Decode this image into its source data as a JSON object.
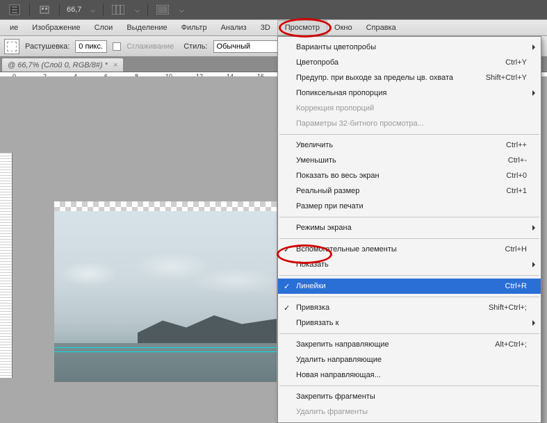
{
  "topbar": {
    "zoom": "66,7"
  },
  "menubar": {
    "items": [
      "ие",
      "Изображение",
      "Слои",
      "Выделение",
      "Фильтр",
      "Анализ",
      "3D",
      "Просмотр",
      "Окно",
      "Справка"
    ]
  },
  "optbar": {
    "feather_label": "Растушевка:",
    "feather_value": "0 пикс.",
    "antialias_label": "Сглаживание",
    "style_label": "Стиль:",
    "style_value": "Обычный"
  },
  "doctab": {
    "title": "@ 66,7% (Слой 0, RGB/8#) *",
    "close": "×"
  },
  "ruler": {
    "marks": [
      "0",
      "2",
      "4",
      "6",
      "8",
      "10",
      "12",
      "14",
      "16"
    ]
  },
  "menu": {
    "items": [
      {
        "label": "Варианты цветопробы",
        "submenu": true
      },
      {
        "label": "Цветопроба",
        "shortcut": "Ctrl+Y"
      },
      {
        "label": "Предупр. при выходе за пределы цв. охвата",
        "shortcut": "Shift+Ctrl+Y"
      },
      {
        "label": "Попиксельная пропорция",
        "submenu": true
      },
      {
        "label": "Коррекция пропорций",
        "disabled": true
      },
      {
        "label": "Параметры 32-битного просмотра...",
        "disabled": true
      },
      {
        "sep": true
      },
      {
        "label": "Увеличить",
        "shortcut": "Ctrl++"
      },
      {
        "label": "Уменьшить",
        "shortcut": "Ctrl+-"
      },
      {
        "label": "Показать во весь экран",
        "shortcut": "Ctrl+0"
      },
      {
        "label": "Реальный размер",
        "shortcut": "Ctrl+1"
      },
      {
        "label": "Размер при печати"
      },
      {
        "sep": true
      },
      {
        "label": "Режимы экрана",
        "submenu": true
      },
      {
        "sep": true
      },
      {
        "label": "Вспомогательные элементы",
        "shortcut": "Ctrl+H",
        "checked": true
      },
      {
        "label": "Показать",
        "submenu": true
      },
      {
        "sep": true
      },
      {
        "label": "Линейки",
        "shortcut": "Ctrl+R",
        "checked": true,
        "hl": true
      },
      {
        "sep": true
      },
      {
        "label": "Привязка",
        "shortcut": "Shift+Ctrl+;",
        "checked": true
      },
      {
        "label": "Привязать к",
        "submenu": true
      },
      {
        "sep": true
      },
      {
        "label": "Закрепить направляющие",
        "shortcut": "Alt+Ctrl+;"
      },
      {
        "label": "Удалить направляющие"
      },
      {
        "label": "Новая направляющая..."
      },
      {
        "sep": true
      },
      {
        "label": "Закрепить фрагменты"
      },
      {
        "label": "Удалить фрагменты",
        "disabled": true
      }
    ]
  }
}
